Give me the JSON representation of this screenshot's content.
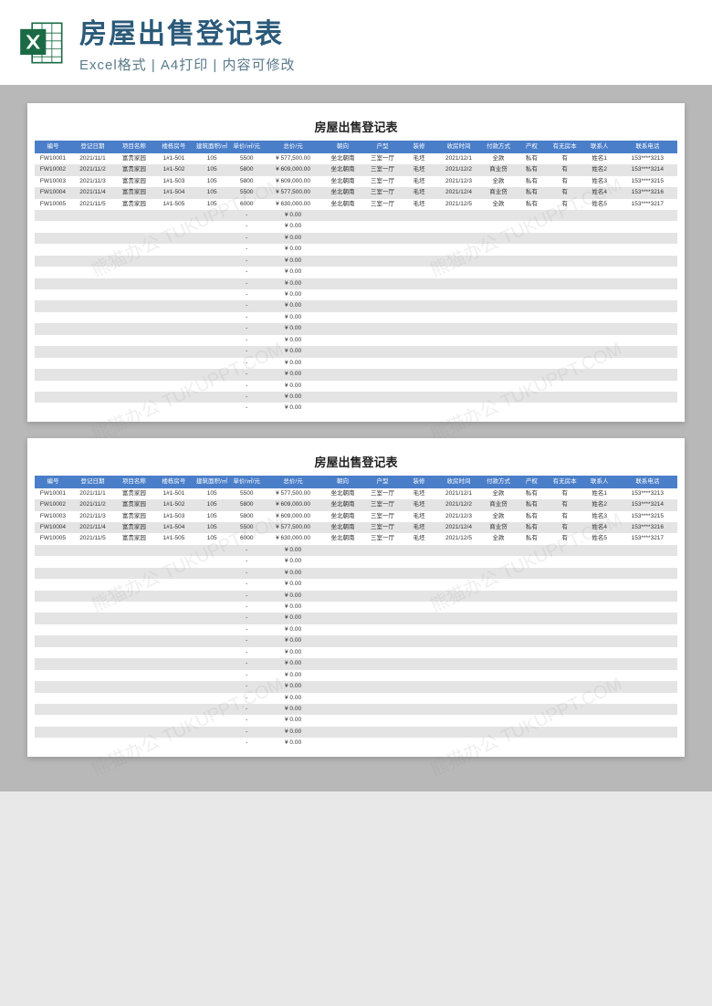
{
  "header": {
    "title": "房屋出售登记表",
    "subtitle": "Excel格式 | A4打印 | 内容可修改"
  },
  "sheet_title": "房屋出售登记表",
  "columns": [
    "编号",
    "登记日期",
    "项目名称",
    "楼栋房号",
    "建筑面积/㎡",
    "单价/㎡/元",
    "总价/元",
    "朝向",
    "户型",
    "装修",
    "收房时间",
    "付款方式",
    "产权",
    "有无房本",
    "联系人",
    "联系电话"
  ],
  "rows": [
    [
      "FW10001",
      "2021/11/1",
      "富贵家园",
      "1#1-501",
      "105",
      "5500",
      "¥ 577,500.00",
      "坐北朝南",
      "三室一厅",
      "毛坯",
      "2021/12/1",
      "全款",
      "私有",
      "有",
      "姓名1",
      "153****3213"
    ],
    [
      "FW10002",
      "2021/11/2",
      "富贵家园",
      "1#1-502",
      "105",
      "5800",
      "¥ 609,000.00",
      "坐北朝南",
      "三室一厅",
      "毛坯",
      "2021/12/2",
      "商业贷",
      "私有",
      "有",
      "姓名2",
      "153****3214"
    ],
    [
      "FW10003",
      "2021/11/3",
      "富贵家园",
      "1#1-503",
      "105",
      "5800",
      "¥ 609,000.00",
      "坐北朝南",
      "三室一厅",
      "毛坯",
      "2021/12/3",
      "全款",
      "私有",
      "有",
      "姓名3",
      "153****3215"
    ],
    [
      "FW10004",
      "2021/11/4",
      "富贵家园",
      "1#1-504",
      "105",
      "5500",
      "¥ 577,500.00",
      "坐北朝南",
      "三室一厅",
      "毛坯",
      "2021/12/4",
      "商业贷",
      "私有",
      "有",
      "姓名4",
      "153****3216"
    ],
    [
      "FW10005",
      "2021/11/5",
      "富贵家园",
      "1#1-505",
      "105",
      "6000",
      "¥ 630,000.00",
      "坐北朝南",
      "三室一厅",
      "毛坯",
      "2021/12/5",
      "全款",
      "私有",
      "有",
      "姓名5",
      "153****3217"
    ]
  ],
  "empty_rows": 18,
  "empty_total": "¥ 0.00",
  "watermark": "熊猫办公 TUKUPPT.COM"
}
